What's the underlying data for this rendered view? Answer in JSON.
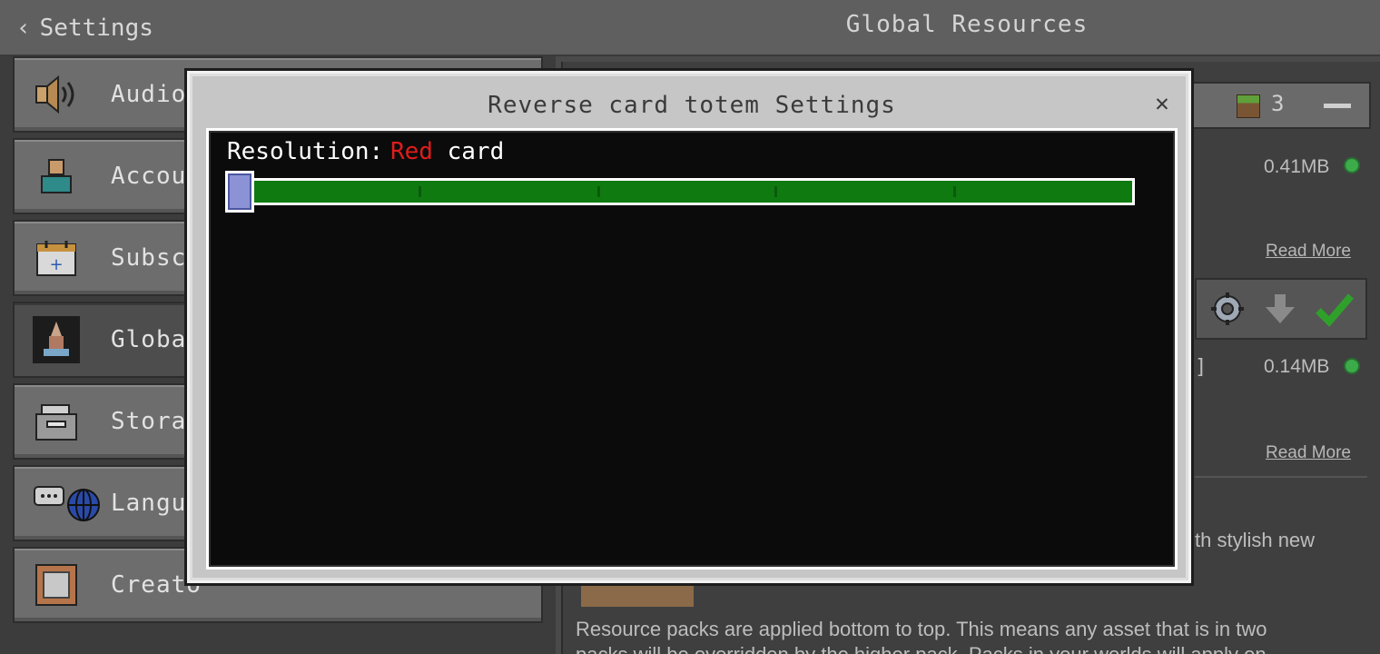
{
  "header": {
    "back_label": "Settings",
    "title": "Global Resources"
  },
  "sidebar": {
    "items": [
      {
        "label": "Audio",
        "icon": "speaker-icon"
      },
      {
        "label": "Accou",
        "icon": "account-icon"
      },
      {
        "label": "Subsc",
        "icon": "subscription-icon"
      },
      {
        "label": "Globa",
        "icon": "global-resources-icon",
        "selected": true
      },
      {
        "label": "Stora",
        "icon": "storage-icon"
      },
      {
        "label": "Langu",
        "icon": "language-icon"
      },
      {
        "label": "Creato",
        "icon": "creator-icon"
      }
    ]
  },
  "background_panel": {
    "pack_count": "3",
    "packs": [
      {
        "size": "0.41MB",
        "read_more": "Read More"
      },
      {
        "size": "0.14MB",
        "read_more": "Read More",
        "bracket": "]"
      }
    ],
    "desc_partial": "th stylish new",
    "footer_text_line1": "Resource packs are applied bottom to top. This means any asset that is in two",
    "footer_text_line2": "packs will be overridden by the higher pack. Packs in your worlds will apply on"
  },
  "modal": {
    "title": "Reverse card totem Settings",
    "close_icon": "close-icon",
    "setting": {
      "label": "Resolution:",
      "value_colored": "Red",
      "value_rest": " card",
      "value_color": "#e01c1c",
      "slider_level": 0,
      "slider_steps": 6
    }
  },
  "colors": {
    "slider_fill": "#0f7a10",
    "slider_thumb": "#8b92d6",
    "status_dot": "#3cab4a"
  }
}
